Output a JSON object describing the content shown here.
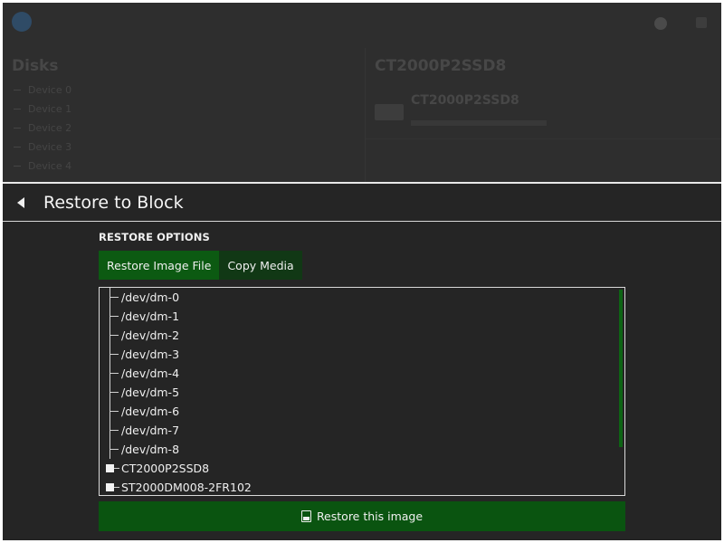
{
  "background": {
    "left_heading": "Disks",
    "left_items": [
      "Device 0",
      "Device 1",
      "Device 2",
      "Device 3",
      "Device 4"
    ],
    "right_heading": "CT2000P2SSD8",
    "right_subheading": "CT2000P2SSD8"
  },
  "panel": {
    "title": "Restore to Block",
    "back_icon": "chevron-left-icon"
  },
  "restore_options": {
    "label": "RESTORE OPTIONS",
    "tabs": [
      {
        "label": "Restore Image File",
        "active": true
      },
      {
        "label": "Copy Media",
        "active": false
      }
    ]
  },
  "devices": [
    {
      "label": "/dev/dm-0",
      "kind": "child"
    },
    {
      "label": "/dev/dm-1",
      "kind": "child"
    },
    {
      "label": "/dev/dm-2",
      "kind": "child"
    },
    {
      "label": "/dev/dm-3",
      "kind": "child"
    },
    {
      "label": "/dev/dm-4",
      "kind": "child"
    },
    {
      "label": "/dev/dm-5",
      "kind": "child"
    },
    {
      "label": "/dev/dm-6",
      "kind": "child"
    },
    {
      "label": "/dev/dm-7",
      "kind": "child"
    },
    {
      "label": "/dev/dm-8",
      "kind": "child"
    },
    {
      "label": "CT2000P2SSD8",
      "kind": "root"
    },
    {
      "label": "ST2000DM008-2FR102",
      "kind": "root"
    }
  ],
  "restore_button": {
    "label": "Restore this image",
    "icon": "save-disk-icon"
  },
  "colors": {
    "accent_green": "#0c5a12",
    "button_green": "#0a5410",
    "panel_background": "#252525"
  }
}
